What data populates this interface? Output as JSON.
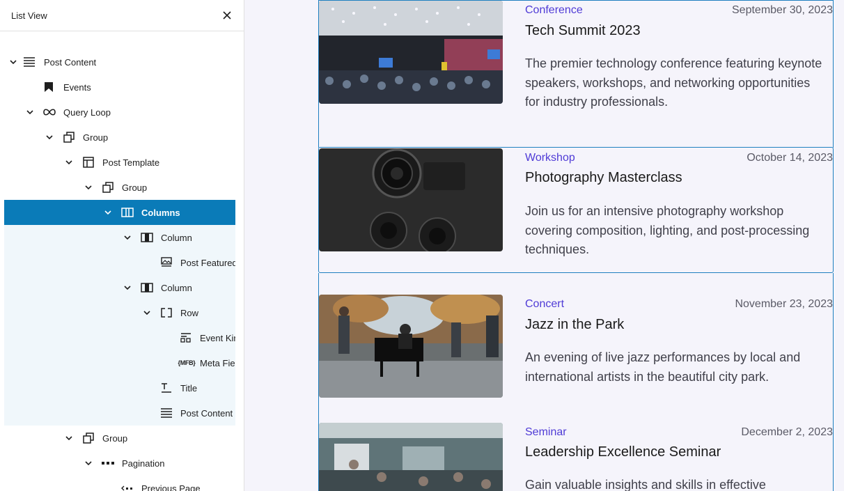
{
  "sidebar": {
    "title": "List View",
    "tree": [
      {
        "label": "Post Content",
        "icon": "align-justify-icon"
      },
      {
        "label": "Events",
        "icon": "bookmark-icon"
      },
      {
        "label": "Query Loop",
        "icon": "loop-icon"
      },
      {
        "label": "Group",
        "icon": "group-icon"
      },
      {
        "label": "Post Template",
        "icon": "layout-icon"
      },
      {
        "label": "Group",
        "icon": "group-icon"
      },
      {
        "label": "Columns",
        "icon": "columns-icon"
      },
      {
        "label": "Column",
        "icon": "column-icon"
      },
      {
        "label": "Post Featured Image",
        "icon": "featured-image-icon"
      },
      {
        "label": "Column",
        "icon": "column-icon"
      },
      {
        "label": "Row",
        "icon": "row-icon"
      },
      {
        "label": "Event Kind",
        "icon": "terms-icon"
      },
      {
        "label": "Meta Field Block",
        "icon": "mfb-icon",
        "icon_text": "{MFB}"
      },
      {
        "label": "Title",
        "icon": "title-icon"
      },
      {
        "label": "Post Content",
        "icon": "align-justify-icon"
      },
      {
        "label": "Group",
        "icon": "group-icon"
      },
      {
        "label": "Pagination",
        "icon": "pagination-icon"
      },
      {
        "label": "Previous Page",
        "icon": "previous-page-icon"
      }
    ]
  },
  "events": [
    {
      "category": "Conference",
      "date": "September 30, 2023",
      "title": "Tech Summit 2023",
      "description": "The premier technology conference featuring keynote speakers, workshops, and networking opportunities for industry professionals.",
      "image": "conference-hall-photo"
    },
    {
      "category": "Workshop",
      "date": "October 14, 2023",
      "title": "Photography Masterclass",
      "description": "Join us for an intensive photography workshop covering composition, lighting, and post-processing techniques.",
      "image": "camera-photo"
    },
    {
      "category": "Concert",
      "date": "November 23, 2023",
      "title": "Jazz in the Park",
      "description": "An evening of live jazz performances by local and international artists in the beautiful city park.",
      "image": "piano-park-photo"
    },
    {
      "category": "Seminar",
      "date": "December 2, 2023",
      "title": "Leadership Excellence Seminar",
      "description": "Gain valuable insights and skills in effective",
      "image": "seminar-room-photo"
    }
  ],
  "colors": {
    "accent": "#0a7bb8",
    "category": "#4f3bd6",
    "selection_border": "#1e7fc0",
    "tint": "#f0f7fb"
  }
}
